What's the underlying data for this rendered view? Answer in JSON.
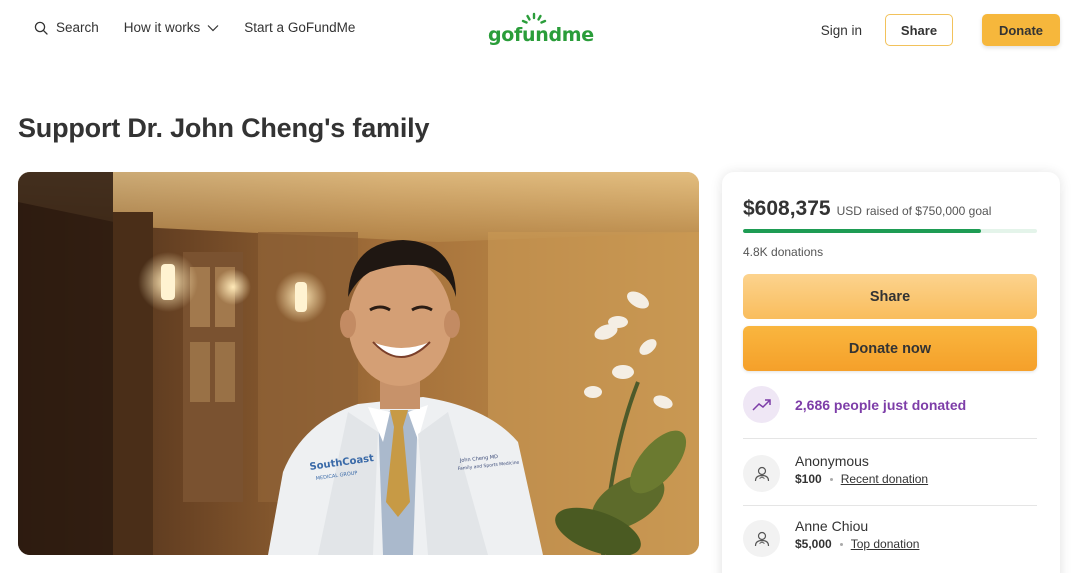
{
  "header": {
    "search_label": "Search",
    "how_it_works_label": "How it works",
    "start_label": "Start a GoFundMe",
    "logo_text": "gofundme",
    "signin_label": "Sign in",
    "share_label": "Share",
    "donate_label": "Donate"
  },
  "campaign": {
    "title": "Support Dr. John Cheng's family"
  },
  "sidebar": {
    "raised_amount": "$608,375",
    "raised_currency": "USD",
    "raised_text": "raised of $750,000 goal",
    "progress_fraction": 0.811,
    "donation_count": "4.8K donations",
    "share_button": "Share",
    "donate_button": "Donate now",
    "trend_text": "2,686 people just donated",
    "donors": [
      {
        "name": "Anonymous",
        "amount": "$100",
        "tag": "Recent donation"
      },
      {
        "name": "Anne Chiou",
        "amount": "$5,000",
        "tag": "Top donation"
      }
    ]
  },
  "colors": {
    "brand_green": "#2a9d3a",
    "donate_orange": "#f6b73c",
    "progress_green": "#1e9c54",
    "trend_purple": "#7d3da8"
  },
  "icons": [
    "search-icon",
    "chevron-down-icon",
    "sun-logo-icon",
    "trend-up-icon",
    "donor-icon"
  ]
}
